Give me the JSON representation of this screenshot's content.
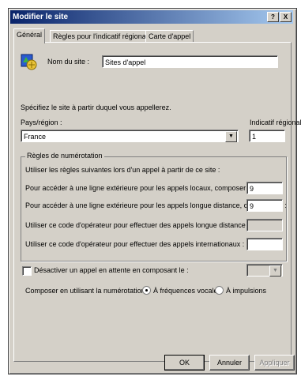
{
  "window": {
    "title": "Modifier le site",
    "help_btn": "?",
    "close_btn": "X"
  },
  "tabs": [
    {
      "label": "Général"
    },
    {
      "label": "Règles pour l'indicatif régional"
    },
    {
      "label": "Carte d'appel"
    }
  ],
  "general": {
    "site_name_label": "Nom du site :",
    "site_name_value": "Sites d'appel",
    "specify_text": "Spécifiez le site à partir duquel vous appellerez.",
    "country_label": "Pays/région :",
    "country_value": "France",
    "area_code_label": "Indicatif régional :",
    "area_code_value": "1"
  },
  "dialing_rules": {
    "group_title": "Règles de numérotation",
    "intro": "Utiliser les règles suivantes lors d'un appel à partir de ce site :",
    "local_label": "Pour accéder à une ligne extérieure pour les appels locaux, composer le :",
    "local_value": "9",
    "long_label": "Pour accéder à une ligne extérieure pour les appels longue distance, composer le :",
    "long_value": "9",
    "carrier_long_label": "Utiliser ce code d'opérateur pour effectuer des appels longue distance :",
    "carrier_intl_label": "Utiliser ce code d'opérateur pour effectuer des appels internationaux :"
  },
  "call_waiting": {
    "label": "Désactiver un appel en attente en composant le :"
  },
  "dial_mode": {
    "label": "Composer en utilisant la numérotation :",
    "tone_label": "À fréquences vocales",
    "pulse_label": "À impulsions"
  },
  "buttons": {
    "ok": "OK",
    "cancel": "Annuler",
    "apply": "Appliquer"
  },
  "colors": {
    "titlebar_start": "#0a246a",
    "titlebar_end": "#a6caf0",
    "face": "#d4d0c8"
  },
  "icons": {
    "site": "phone-globe-icon",
    "dropdown": "chevron-down-icon"
  }
}
